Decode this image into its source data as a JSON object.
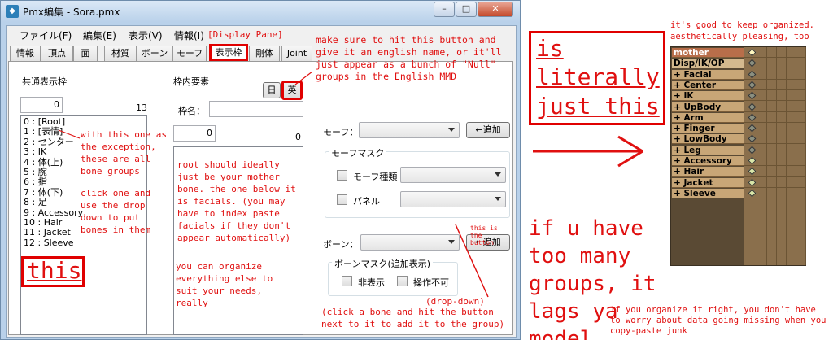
{
  "window": {
    "title": "Pmx編集 - Sora.pmx",
    "icon": "app-icon",
    "minimize_icon": "minimize-icon",
    "maximize_icon": "maximize-icon",
    "close_icon": "close-icon"
  },
  "menu": [
    {
      "label": "ファイル(F)"
    },
    {
      "label": "編集(E)"
    },
    {
      "label": "表示(V)"
    },
    {
      "label": "情報(I)"
    }
  ],
  "tabs": [
    {
      "label": "情報"
    },
    {
      "label": "頂点"
    },
    {
      "label": "面"
    },
    {
      "label": "材質"
    },
    {
      "label": "ボーン"
    },
    {
      "label": "モーフ"
    },
    {
      "label": "表示枠",
      "active": true
    },
    {
      "label": "剛体"
    },
    {
      "label": "Joint"
    }
  ],
  "left_panel": {
    "header": "共通表示枠",
    "index_value": "0",
    "count": "13",
    "items": [
      "0 : [Root]",
      "1 : [表情]",
      "2 : センター",
      "3 : IK",
      "4 : 体(上)",
      "5 : 腕",
      "6 : 指",
      "7 : 体(下)",
      "8 : 足",
      "9 : Accessory",
      "10 : Hair",
      "11 : Jacket",
      "12 : Sleeve"
    ]
  },
  "middle_panel": {
    "header": "枠内要素",
    "lang_jp": "日",
    "lang_en": "英",
    "name_label": "枠名：",
    "name_value": "",
    "index_value": "0",
    "count": "0"
  },
  "right_panel": {
    "morph_label": "モーフ：",
    "morph_add": "←追加",
    "morph_mask_title": "モーフマスク",
    "morph_type_label": "モーフ種類",
    "panel_label": "パネル",
    "bone_label": "ボーン：",
    "bone_add": "←追加",
    "bone_mask_title": "ボーンマスク(追加表示)",
    "hidden_label": "非表示",
    "locked_label": "操作不可"
  },
  "annotations": {
    "display_pane": "[Display Pane]",
    "english_name": "make sure to hit this button and give it an english name, or it'll just appear as a bunch of \"Null\" groups in the English MMD",
    "exception": "with this one as the exception, these are all bone groups",
    "click_one": "click one and use the drop down to put bones in them",
    "this": "this",
    "root_note": "root should ideally just be your mother bone. the one below it is facials. (you may have to index paste facials if they don't appear automatically)",
    "organize": "you can organize everything else to suit your needs, really",
    "this_button": "this is the button",
    "dropdown": "(drop-down)",
    "click_bone": "(click a bone and hit the button next to it to add it to the group)",
    "literally_1": "is",
    "literally_2": "literally",
    "literally_3": "just this",
    "keep_organized": "it's good to keep organized. aesthetically pleasing, too",
    "too_many": "if u have too many groups, it lags ya model",
    "copy_paste": "if you organize it right, you don't have to worry about data going missing when you copy-paste junk"
  },
  "mmd_panel": {
    "rows": [
      {
        "label": "mother",
        "style": "hdr"
      },
      {
        "label": "Disp/IK/OP",
        "style": "hdr2"
      },
      {
        "label": "+ Facial"
      },
      {
        "label": "+ Center"
      },
      {
        "label": "+ IK"
      },
      {
        "label": "+ UpBody"
      },
      {
        "label": "+ Arm"
      },
      {
        "label": "+ Finger"
      },
      {
        "label": "+ LowBody"
      },
      {
        "label": "+ Leg"
      },
      {
        "label": "+ Accessory"
      },
      {
        "label": "+ Hair"
      },
      {
        "label": "+ Jacket"
      },
      {
        "label": "+ Sleeve"
      }
    ]
  },
  "colors": {
    "annotation_red": "#e01010",
    "mmd_header": "#b86e4a",
    "mmd_row": "#c8a677"
  }
}
